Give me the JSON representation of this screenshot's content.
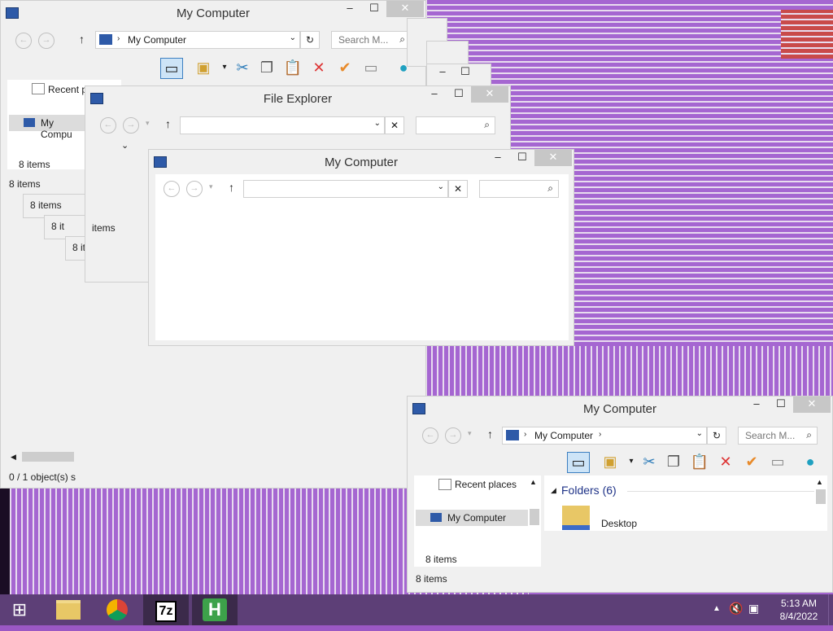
{
  "windows": {
    "w1": {
      "title": "My Computer",
      "location": "My Computer",
      "search_placeholder": "Search M...",
      "nav": [
        "Recent p",
        "My Compu"
      ],
      "items_a": "8 items",
      "items_b": "8 items",
      "status": "0 / 1 object(s) s"
    },
    "stack": {
      "items1": "8 items",
      "items2": "8 it",
      "items3": "8 it",
      "items4": "8 items",
      "items5": "items"
    },
    "fe": {
      "title": "File Explorer"
    },
    "w3": {
      "title": "My Computer"
    },
    "w4": {
      "title": "My Computer",
      "location": "My Computer",
      "search_placeholder": "Search M...",
      "nav_recent": "Recent places",
      "nav_mycomp": "My Computer",
      "section": "Folders (6)",
      "folder": "Desktop",
      "items_a": "8 items",
      "items_b": "8 items"
    }
  },
  "taskbar": {
    "icons": [
      "windows-start",
      "file-explorer",
      "chrome",
      "7-zip",
      "hex-editor"
    ],
    "sevenzip_label": "7z",
    "hex_label": "H",
    "time": "5:13 AM",
    "date": "8/4/2022"
  },
  "colors": {
    "wallpaper": "#a566d1",
    "taskbar": "#5d3f77",
    "close": "#c7c7c7"
  }
}
